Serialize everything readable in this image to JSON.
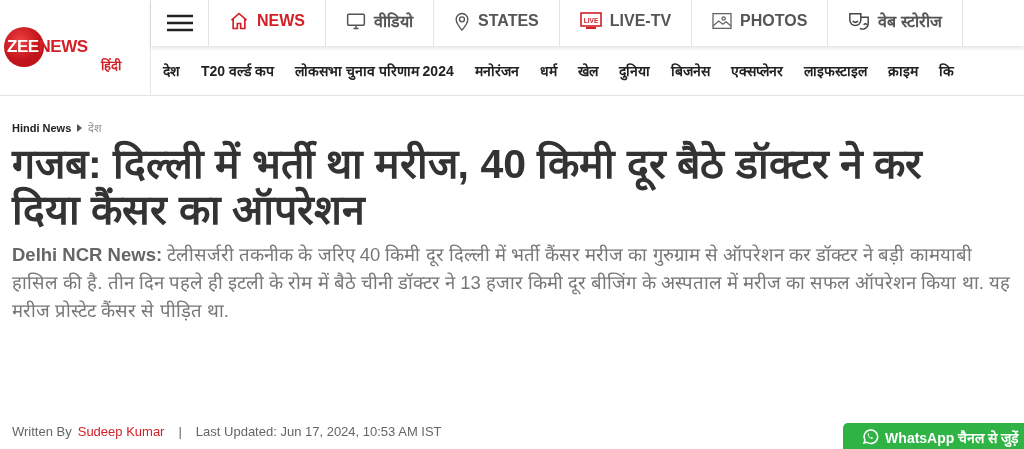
{
  "logo": {
    "brand": "ZEENEWS",
    "sub": "हिंदी"
  },
  "top_nav": [
    {
      "kind": "home",
      "label": "NEWS",
      "selected": true
    },
    {
      "kind": "monitor",
      "label": "वीडियो",
      "selected": false
    },
    {
      "kind": "pin",
      "label": "STATES",
      "selected": false
    },
    {
      "kind": "live",
      "label": "LIVE-TV",
      "selected": false,
      "badge": "LIVE"
    },
    {
      "kind": "image",
      "label": "PHOTOS",
      "selected": false
    },
    {
      "kind": "masks",
      "label": "वेब स्टोरीज",
      "selected": false
    }
  ],
  "categories": [
    "देश",
    "T20 वर्ल्ड कप",
    "लोकसभा चुनाव परिणाम 2024",
    "मनोरंजन",
    "धर्म",
    "खेल",
    "दुनिया",
    "बिजनेस",
    "एक्सप्लेनर",
    "लाइफस्टाइल",
    "क्राइम",
    "कि"
  ],
  "breadcrumb": [
    "Hindi News",
    "देश"
  ],
  "headline": "गजब: दिल्ली में भर्ती था मरीज, 40 किमी दूर बैठे डॉक्टर ने कर दिया कैंसर का ऑपरेशन",
  "summary": "**Delhi NCR News:** टेलीसर्जरी तकनीक के जरिए 40 किमी दूर दिल्ली में भर्ती कैंसर मरीज का गुरुग्राम से ऑपरेशन कर डॉक्टर ने बड़ी कामयाबी हासिल की है. तीन दिन पहले ही इटली के रोम में बैठे चीनी डॉक्टर ने 13 हजार किमी दूर बीजिंग के अस्पताल में मरीज का सफल ऑपरेशन किया था. यह मरीज प्रोस्टेट कैंसर से पीड़ित था.",
  "byline": {
    "prefix": "Written By",
    "author": "Sudeep Kumar",
    "separator": "|",
    "updated": "Last Updated: Jun 17, 2024, 10:53 AM IST"
  },
  "whatsapp": {
    "label": "WhatsApp चैनल से जुड़ें"
  }
}
